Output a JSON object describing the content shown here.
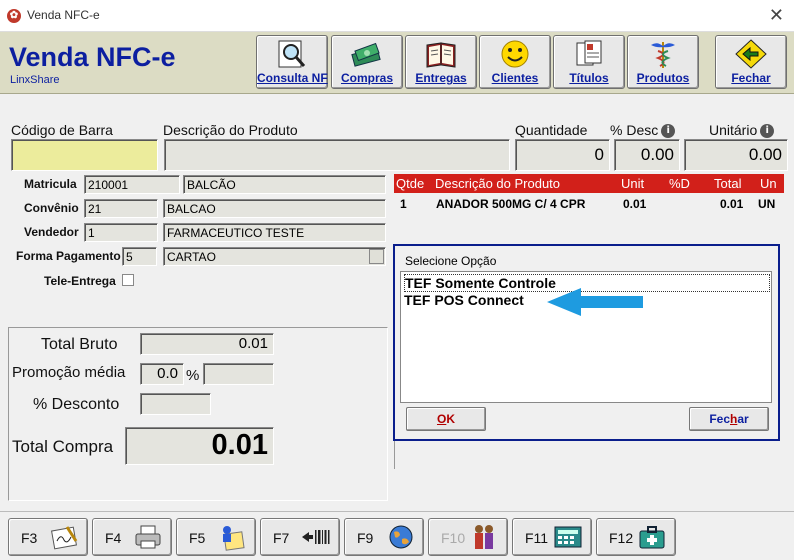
{
  "window": {
    "title": "Venda NFC-e",
    "close_glyph": "✕"
  },
  "header": {
    "app_title": "Venda NFC-e",
    "subtitle": "LinxShare",
    "toolbar": [
      {
        "label": "Consulta NF",
        "icon": "magnifier-icon"
      },
      {
        "label": "Compras",
        "icon": "money-icon"
      },
      {
        "label": "Entregas",
        "icon": "book-icon"
      },
      {
        "label": "Clientes",
        "icon": "smiley-icon"
      },
      {
        "label": "Títulos",
        "icon": "documents-icon"
      },
      {
        "label": "Produtos",
        "icon": "caduceus-icon"
      },
      {
        "label": "Fechar",
        "icon": "exit-arrow-icon"
      }
    ]
  },
  "product_entry": {
    "barcode_label": "Código de Barra",
    "barcode_value": "",
    "description_label": "Descrição do Produto",
    "description_value": "",
    "quantity_label": "Quantidade",
    "quantity_value": "0",
    "discount_label": "% Desc",
    "discount_value": "0.00",
    "unit_label": "Unitário",
    "unit_value": "0.00"
  },
  "customer": {
    "matricula_label": "Matricula",
    "matricula_code": "210001",
    "matricula_name": "BALCÃO",
    "convenio_label": "Convênio",
    "convenio_code": "21",
    "convenio_name": "BALCAO",
    "vendedor_label": "Vendedor",
    "vendedor_code": "1",
    "vendedor_name": "FARMACEUTICO TESTE",
    "pagamento_label": "Forma Pagamento",
    "pagamento_code": "5",
    "pagamento_name": "CARTAO",
    "tele_label": "Tele-Entrega",
    "tele_checked": false
  },
  "totals": {
    "bruto_label": "Total Bruto",
    "bruto_value": "0.01",
    "promocao_label": "Promoção média",
    "promocao_value": "0.0",
    "promocao_pct": "%",
    "desconto_label": "% Desconto",
    "desconto_value": "",
    "compra_label": "Total Compra",
    "compra_value": "0.01"
  },
  "grid": {
    "headers": {
      "qtde": "Qtde",
      "descricao": "Descrição do Produto",
      "unit": "Unit",
      "pd": "%D",
      "total": "Total",
      "un": "Un"
    },
    "rows": [
      {
        "qtde": "1",
        "descricao": "ANADOR 500MG C/ 4 CPR",
        "unit": "0.01",
        "pd": "",
        "total": "0.01",
        "un": "UN"
      }
    ]
  },
  "dialog": {
    "title": "Selecione Opção",
    "options": [
      "TEF Somente Controle",
      "TEF POS Connect"
    ],
    "selected_index": 0,
    "ok_label_pre": "",
    "ok_label_u": "O",
    "ok_label_post": "K",
    "close_label_pre": "Fec",
    "close_label_u": "h",
    "close_label_post": "ar",
    "arrow_color": "#1e9be0"
  },
  "function_keys": [
    {
      "key": "F3",
      "icon": "signature-icon",
      "enabled": true
    },
    {
      "key": "F4",
      "icon": "printer-icon",
      "enabled": true
    },
    {
      "key": "F5",
      "icon": "person-notepad-icon",
      "enabled": true
    },
    {
      "key": "F7",
      "icon": "barcode-arrow-icon",
      "enabled": true
    },
    {
      "key": "F9",
      "icon": "globe-icon",
      "enabled": true
    },
    {
      "key": "F10",
      "icon": "people-icon",
      "enabled": false
    },
    {
      "key": "F11",
      "icon": "calculator-icon",
      "enabled": true
    },
    {
      "key": "F12",
      "icon": "first-aid-icon",
      "enabled": true
    }
  ]
}
